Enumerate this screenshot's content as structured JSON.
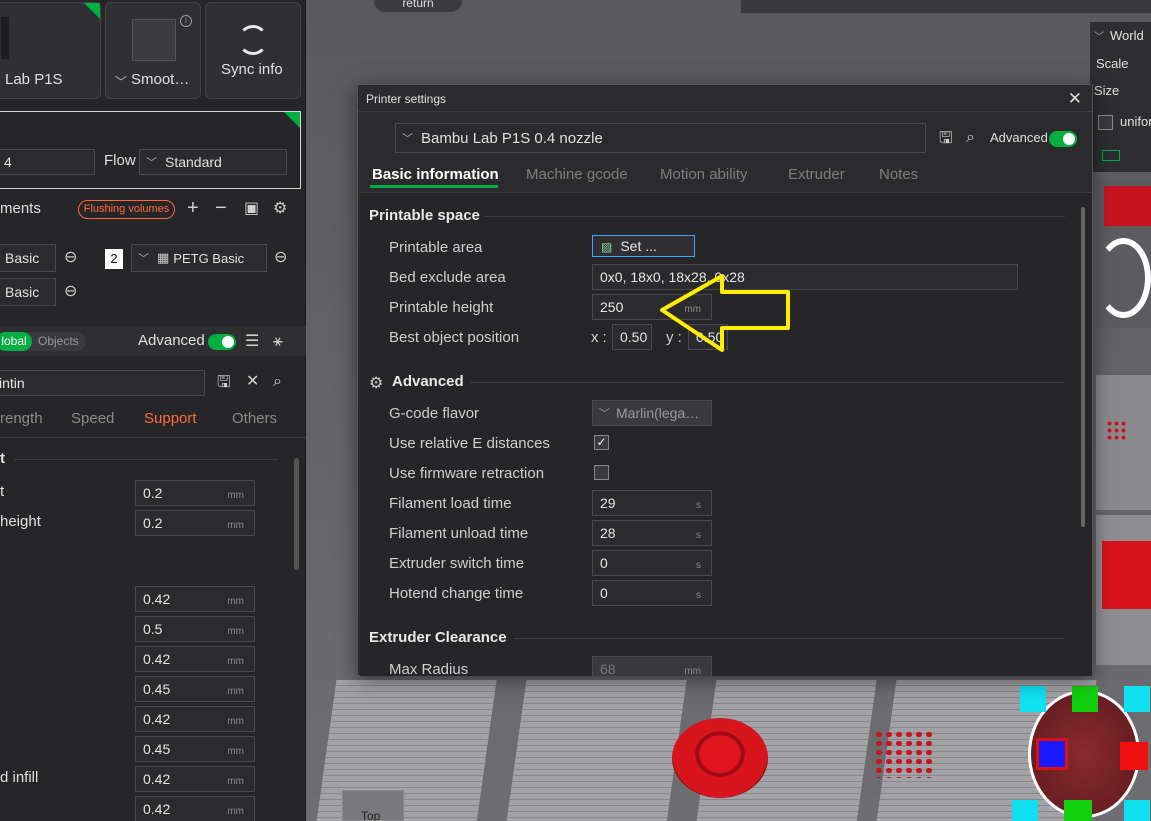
{
  "left_panel": {
    "printer_name": "Lab P1S",
    "plate_label": "Smoot…",
    "sync_label": "Sync info",
    "nozzle_value": "4",
    "flow_label": "Flow",
    "flow_value": "Standard",
    "filaments_label": "ments",
    "flushing_label": "Flushing volumes",
    "filament_1": "Basic",
    "filament_2_index": "2",
    "filament_2": "PETG Basic",
    "filament_3": "Basic",
    "mode_global": "lobal",
    "mode_objects": "Objects",
    "advanced_label": "Advanced",
    "search_value": "intin",
    "tabs": [
      "rength",
      "Speed",
      "Support",
      "Others"
    ],
    "section_partial": "t",
    "settings": [
      {
        "label": "t",
        "value": "0.2",
        "unit": "mm"
      },
      {
        "label": "height",
        "value": "0.2",
        "unit": "mm"
      },
      {
        "label": "",
        "value": "0.42",
        "unit": "mm"
      },
      {
        "label": "",
        "value": "0.5",
        "unit": "mm"
      },
      {
        "label": "",
        "value": "0.42",
        "unit": "mm"
      },
      {
        "label": "",
        "value": "0.45",
        "unit": "mm"
      },
      {
        "label": "",
        "value": "0.42",
        "unit": "mm"
      },
      {
        "label": "",
        "value": "0.45",
        "unit": "mm"
      },
      {
        "label": "d infill",
        "value": "0.42",
        "unit": "mm"
      },
      {
        "label": "",
        "value": "0.42",
        "unit": "mm"
      }
    ]
  },
  "viewport": {
    "return_label": "return",
    "world_label": "World",
    "scale_label": "Scale",
    "size_label": "Size",
    "uniform_label": "unifor",
    "view_label": "Top"
  },
  "dialog": {
    "title": "Printer settings",
    "preset": "Bambu Lab P1S 0.4 nozzle",
    "advanced_label": "Advanced",
    "tabs": [
      "Basic information",
      "Machine gcode",
      "Motion ability",
      "Extruder",
      "Notes"
    ],
    "printable_space": {
      "heading": "Printable space",
      "printable_area_label": "Printable area",
      "set_button": "Set ...",
      "bed_exclude_label": "Bed exclude area",
      "bed_exclude_value": "0x0, 18x0, 18x28, 0x28",
      "printable_height_label": "Printable height",
      "printable_height_value": "250",
      "printable_height_unit": "mm",
      "best_position_label": "Best object position",
      "x_label": "x :",
      "x_value": "0.50",
      "y_label": "y :",
      "y_value": "0.50"
    },
    "advanced": {
      "heading": "Advanced",
      "gcode_flavor_label": "G-code flavor",
      "gcode_flavor_value": "Marlin(lega…",
      "relative_e_label": "Use relative E distances",
      "relative_e_checked": true,
      "firmware_retraction_label": "Use firmware retraction",
      "firmware_retraction_checked": false,
      "filament_load_label": "Filament load time",
      "filament_load_value": "29",
      "filament_unload_label": "Filament unload time",
      "filament_unload_value": "28",
      "extruder_switch_label": "Extruder switch time",
      "extruder_switch_value": "0",
      "hotend_change_label": "Hotend change time",
      "hotend_change_value": "0",
      "time_unit": "s"
    },
    "extruder_clearance": {
      "heading": "Extruder Clearance",
      "max_radius_label": "Max Radius",
      "max_radius_value": "68",
      "max_radius_unit": "mm"
    }
  },
  "colors": {
    "accent": "#00ae42",
    "support_tab": "#ff6a3d",
    "annotation_arrow": "#ffee00"
  }
}
